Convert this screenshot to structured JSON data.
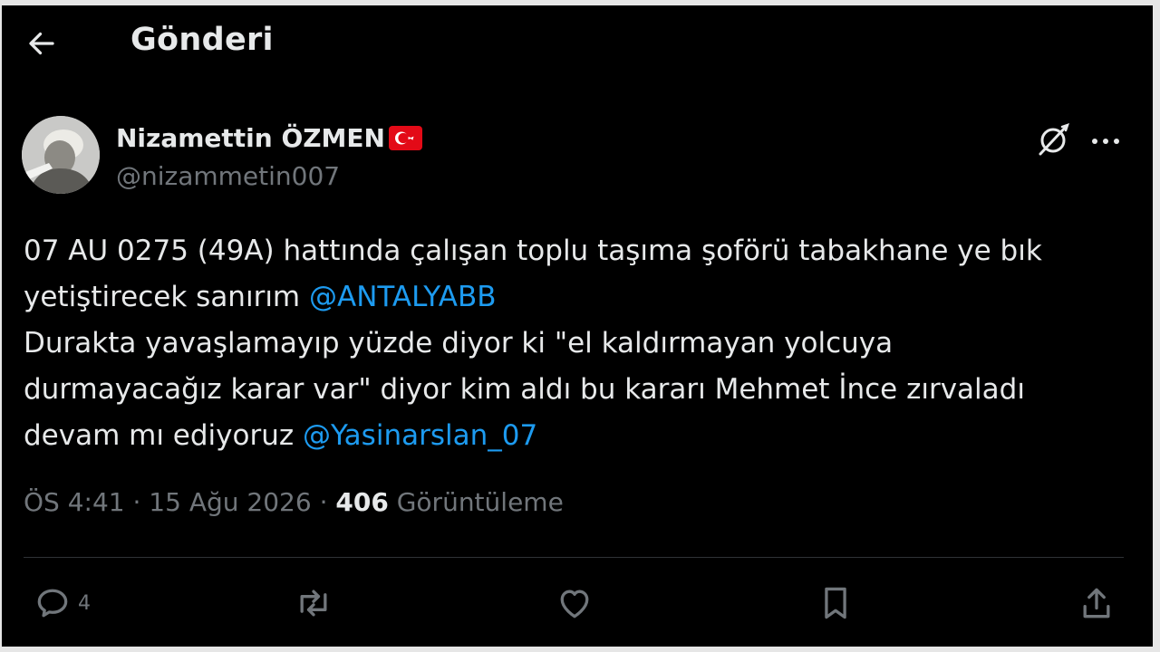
{
  "header": {
    "title": "Gönderi",
    "back_icon": "arrow-left-icon"
  },
  "tweet": {
    "author": {
      "name": "Nizamettin ÖZMEN",
      "handle": "@nizammetin007",
      "flag_icon": "turkey-flag-icon"
    },
    "lines": {
      "l1": "07 AU 0275 (49A) hattında çalışan toplu taşıma şoförü tabakhane ye bık",
      "l2_text": "yetiştirecek sanırım ",
      "l2_mention": "@ANTALYABB",
      "l3": "Durakta yavaşlamayıp yüzde diyor ki \"el kaldırmayan yolcuya",
      "l4": "durmayacağız karar var\" diyor kim aldı bu kararı Mehmet İnce zırvaladı",
      "l5_text": "devam mı ediyoruz ",
      "l5_mention": "@Yasinarslan_07"
    },
    "meta": {
      "time": "ÖS 4:41",
      "separator": " · ",
      "date": "15 Ağu 2026",
      "views_count": "406",
      "views_label": " Görüntüleme"
    },
    "actions": {
      "reply_count": "4"
    }
  },
  "colors": {
    "background": "#000000",
    "text": "#e7e9ea",
    "muted": "#71767b",
    "link": "#1d9bf0",
    "divider": "#2f3336"
  }
}
